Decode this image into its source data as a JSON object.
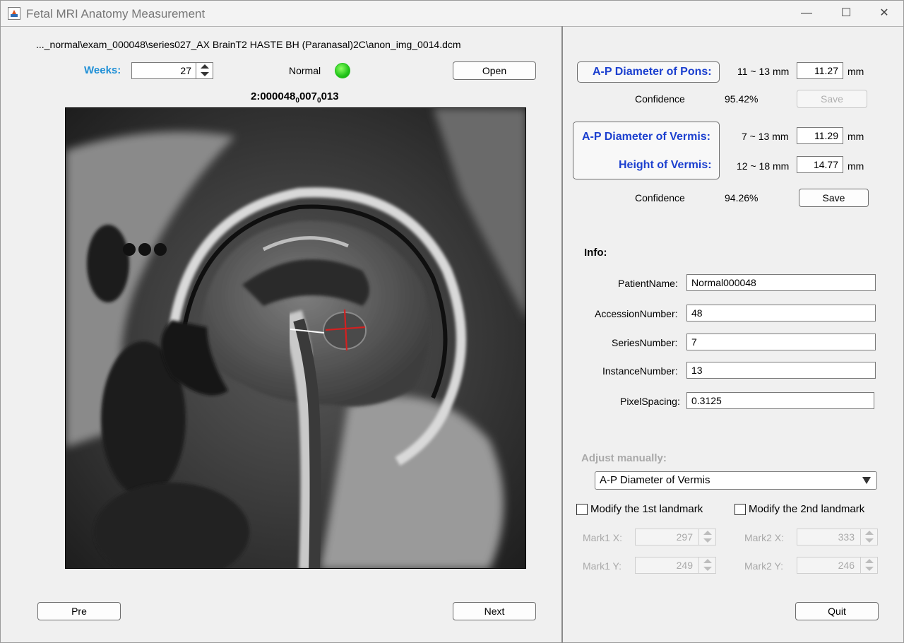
{
  "window": {
    "title": "Fetal MRI Anatomy Measurement",
    "min_glyph": "—",
    "max_glyph": "☐",
    "close_glyph": "✕"
  },
  "left": {
    "filepath": "..._normal\\exam_000048\\series027_AX BrainT2 HASTE BH (Paranasal)2C\\anon_img_0014.dcm",
    "weeks_label": "Weeks:",
    "weeks_value": "27",
    "status_text": "Normal",
    "status_color": "#22c41a",
    "open_label": "Open",
    "image_id": "2:000048",
    "image_id_sub1": "0",
    "image_id_mid": "007",
    "image_id_sub2": "0",
    "image_id_end": "013",
    "pre_label": "Pre",
    "next_label": "Next"
  },
  "measurements": {
    "pons": {
      "label": "A-P Diameter of Pons:",
      "range": "11 ~ 13 mm",
      "value": "11.27",
      "unit": "mm",
      "confidence_label": "Confidence",
      "confidence": "95.42%",
      "save_label": "Save"
    },
    "vermis_ap": {
      "label": "A-P Diameter of Vermis:",
      "range": "7 ~ 13 mm",
      "value": "11.29",
      "unit": "mm"
    },
    "vermis_height": {
      "label": "Height of Vermis:",
      "range": "12 ~ 18 mm",
      "value": "14.77",
      "unit": "mm"
    },
    "vermis_confidence_label": "Confidence",
    "vermis_confidence": "94.26%",
    "vermis_save_label": "Save"
  },
  "info": {
    "heading": "Info:",
    "fields": [
      {
        "label": "PatientName:",
        "value": "Normal000048"
      },
      {
        "label": "AccessionNumber:",
        "value": "48"
      },
      {
        "label": "SeriesNumber:",
        "value": "7"
      },
      {
        "label": "InstanceNumber:",
        "value": "13"
      },
      {
        "label": "PixelSpacing:",
        "value": "0.3125"
      }
    ]
  },
  "adjust": {
    "heading": "Adjust manually:",
    "dropdown_value": "A-P Diameter of Vermis",
    "modify1_label": "Modify the 1st landmark",
    "modify2_label": "Modify the 2nd landmark",
    "mark1x_label": "Mark1 X:",
    "mark1x_value": "297",
    "mark1y_label": "Mark1 Y:",
    "mark1y_value": "249",
    "mark2x_label": "Mark2 X:",
    "mark2x_value": "333",
    "mark2y_label": "Mark2 Y:",
    "mark2y_value": "246"
  },
  "quit_label": "Quit"
}
